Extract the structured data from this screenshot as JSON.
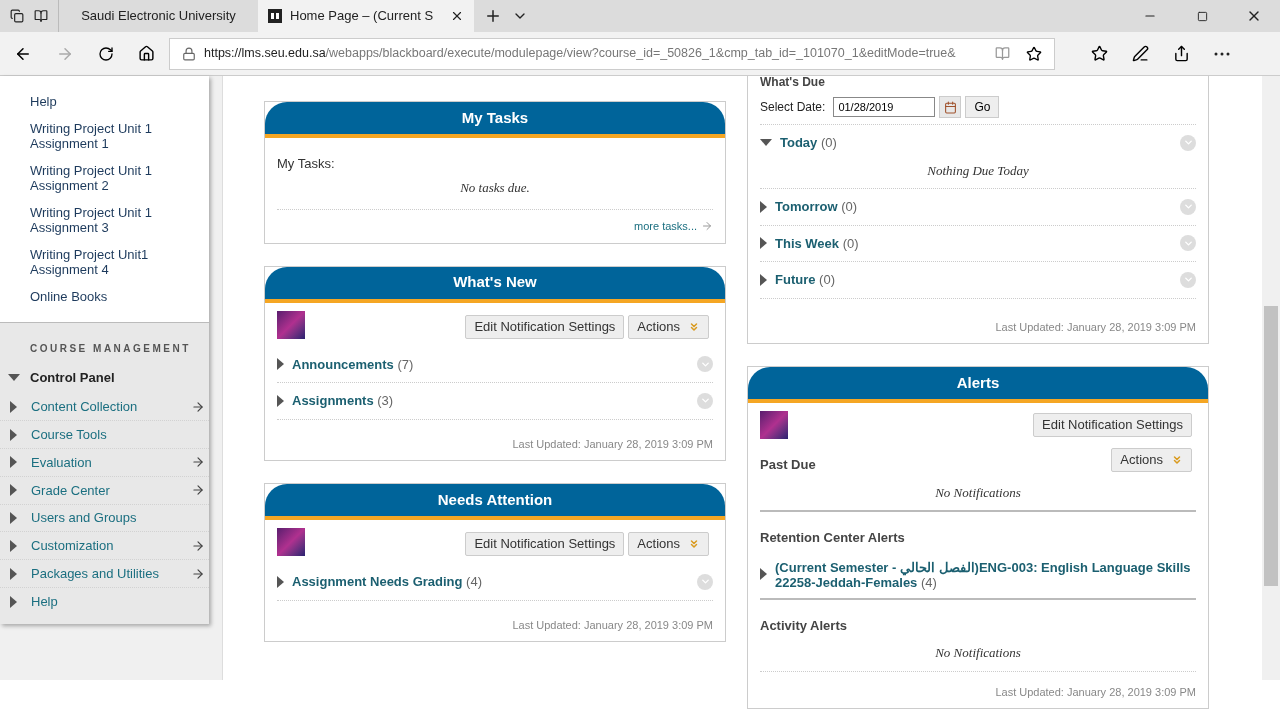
{
  "browser": {
    "tabs": [
      {
        "title": "Saudi Electronic University",
        "selected": false,
        "kind": "plain"
      },
      {
        "title": "Home Page – (Current S",
        "selected": true,
        "kind": "bb"
      }
    ],
    "url_host": "https://lms.seu.edu.sa",
    "url_path": "/webapps/blackboard/execute/modulepage/view?course_id=_50826_1&cmp_tab_id=_101070_1&editMode=true&"
  },
  "sidebar": {
    "items": [
      "Help",
      "Writing Project Unit 1 Assignment 1",
      "Writing Project Unit 1 Assignment 2",
      "Writing Project Unit 1 Assignment 3",
      "Writing Project Unit1 Assignment 4",
      "Online Books"
    ],
    "section_title": "COURSE MANAGEMENT",
    "control_panel": {
      "label": "Control Panel",
      "expanded": true,
      "items": [
        {
          "label": "Content Collection",
          "has_arrow": true
        },
        {
          "label": "Course Tools",
          "has_arrow": false
        },
        {
          "label": "Evaluation",
          "has_arrow": true
        },
        {
          "label": "Grade Center",
          "has_arrow": true
        },
        {
          "label": "Users and Groups",
          "has_arrow": false
        },
        {
          "label": "Customization",
          "has_arrow": true
        },
        {
          "label": "Packages and Utilities",
          "has_arrow": true
        },
        {
          "label": "Help",
          "has_arrow": false
        }
      ]
    }
  },
  "left_modules": [
    {
      "kind": "tasks",
      "title": "My Tasks",
      "label": "My Tasks:",
      "empty_text": "No tasks due.",
      "link": "more tasks..."
    },
    {
      "kind": "notify",
      "title": "What's New",
      "edit_button": "Edit Notification Settings",
      "actions_button": "Actions",
      "rows": [
        {
          "label": "Announcements",
          "count": "(7)",
          "expanded": false
        },
        {
          "label": "Assignments",
          "count": "(3)",
          "expanded": false
        }
      ],
      "updated": "Last Updated: January 28, 2019 3:09 PM"
    },
    {
      "kind": "notify",
      "title": "Needs Attention",
      "edit_button": "Edit Notification Settings",
      "actions_button": "Actions",
      "rows": [
        {
          "label": "Assignment Needs Grading",
          "count": "(4)",
          "expanded": false
        }
      ],
      "updated": "Last Updated: January 28, 2019 3:09 PM"
    }
  ],
  "whats_due": {
    "title": "What's Due",
    "date_label": "Select Date:",
    "date_value": "01/28/2019",
    "go_button": "Go",
    "rows": [
      {
        "label": "Today",
        "count": "(0)",
        "expanded": true,
        "empty_text": "Nothing Due Today"
      },
      {
        "label": "Tomorrow",
        "count": "(0)",
        "expanded": false
      },
      {
        "label": "This Week",
        "count": "(0)",
        "expanded": false
      },
      {
        "label": "Future",
        "count": "(0)",
        "expanded": false
      }
    ],
    "updated": "Last Updated: January 28, 2019 3:09 PM"
  },
  "alerts": {
    "title": "Alerts",
    "edit_button": "Edit Notification Settings",
    "actions_button": "Actions",
    "sections": [
      {
        "heading": "Past Due",
        "empty_text": "No Notifications"
      },
      {
        "heading": "Retention Center Alerts",
        "rows": [
          {
            "label": "(Current Semester - الفصل الحالي)ENG-003: English Language Skills 22258-Jeddah-Females",
            "count": "(4)",
            "expanded": false
          }
        ]
      },
      {
        "heading": "Activity Alerts",
        "empty_text": "No Notifications"
      }
    ],
    "updated": "Last Updated: January 28, 2019 3:09 PM"
  }
}
